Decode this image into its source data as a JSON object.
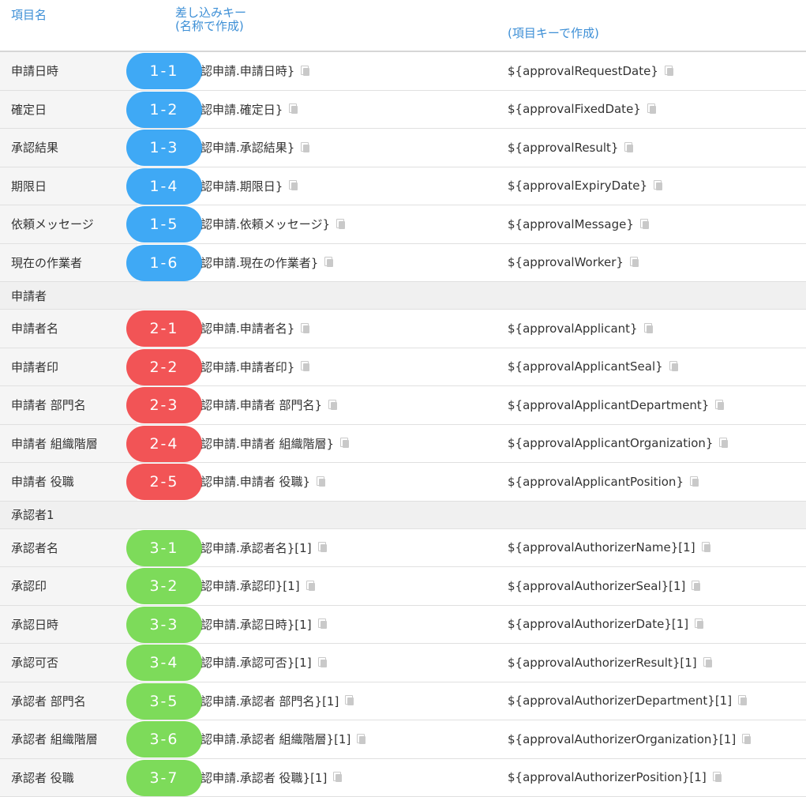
{
  "header": {
    "col1": "項目名",
    "col2_line1": "差し込みキー",
    "col2_line2": "(名称で作成)",
    "col3": "(項目キーで作成)"
  },
  "colors": {
    "header_text": "#3d8fd6",
    "badge_blue": "#3fa9f5",
    "badge_red": "#f25456",
    "badge_green": "#7ddb5a"
  },
  "icons": {
    "copy": "copy-icon"
  },
  "sections": [
    {
      "title": "",
      "rows": [
        {
          "label": "申請日時",
          "name_key": "認申請.申請日時}",
          "item_key": "${approvalRequestDate}",
          "badge": "1-1",
          "color": "blue"
        },
        {
          "label": "確定日",
          "name_key": "認申請.確定日}",
          "item_key": "${approvalFixedDate}",
          "badge": "1-2",
          "color": "blue"
        },
        {
          "label": "承認結果",
          "name_key": "認申請.承認結果}",
          "item_key": "${approvalResult}",
          "badge": "1-3",
          "color": "blue"
        },
        {
          "label": "期限日",
          "name_key": "認申請.期限日}",
          "item_key": "${approvalExpiryDate}",
          "badge": "1-4",
          "color": "blue"
        },
        {
          "label": "依頼メッセージ",
          "name_key": "認申請.依頼メッセージ}",
          "item_key": "${approvalMessage}",
          "badge": "1-5",
          "color": "blue"
        },
        {
          "label": "現在の作業者",
          "name_key": "認申請.現在の作業者}",
          "item_key": "${approvalWorker}",
          "badge": "1-6",
          "color": "blue"
        }
      ]
    },
    {
      "title": "申請者",
      "rows": [
        {
          "label": "申請者名",
          "name_key": "認申請.申請者名}",
          "item_key": "${approvalApplicant}",
          "badge": "2-1",
          "color": "red"
        },
        {
          "label": "申請者印",
          "name_key": "認申請.申請者印}",
          "item_key": "${approvalApplicantSeal}",
          "badge": "2-2",
          "color": "red"
        },
        {
          "label": "申請者 部門名",
          "name_key": "認申請.申請者 部門名}",
          "item_key": "${approvalApplicantDepartment}",
          "badge": "2-3",
          "color": "red"
        },
        {
          "label": "申請者 組織階層",
          "name_key": "認申請.申請者 組織階層}",
          "item_key": "${approvalApplicantOrganization}",
          "badge": "2-4",
          "color": "red"
        },
        {
          "label": "申請者 役職",
          "name_key": "認申請.申請者 役職}",
          "item_key": "${approvalApplicantPosition}",
          "badge": "2-5",
          "color": "red"
        }
      ]
    },
    {
      "title": "承認者1",
      "rows": [
        {
          "label": "承認者名",
          "name_key": "認申請.承認者名}[1]",
          "item_key": "${approvalAuthorizerName}[1]",
          "badge": "3-1",
          "color": "green"
        },
        {
          "label": "承認印",
          "name_key": "認申請.承認印}[1]",
          "item_key": "${approvalAuthorizerSeal}[1]",
          "badge": "3-2",
          "color": "green"
        },
        {
          "label": "承認日時",
          "name_key": "認申請.承認日時}[1]",
          "item_key": "${approvalAuthorizerDate}[1]",
          "badge": "3-3",
          "color": "green"
        },
        {
          "label": "承認可否",
          "name_key": "認申請.承認可否}[1]",
          "item_key": "${approvalAuthorizerResult}[1]",
          "badge": "3-4",
          "color": "green"
        },
        {
          "label": "承認者 部門名",
          "name_key": "認申請.承認者 部門名}[1]",
          "item_key": "${approvalAuthorizerDepartment}[1]",
          "badge": "3-5",
          "color": "green"
        },
        {
          "label": "承認者 組織階層",
          "name_key": "認申請.承認者 組織階層}[1]",
          "item_key": "${approvalAuthorizerOrganization}[1]",
          "badge": "3-6",
          "color": "green"
        },
        {
          "label": "承認者 役職",
          "name_key": "認申請.承認者 役職}[1]",
          "item_key": "${approvalAuthorizerPosition}[1]",
          "badge": "3-7",
          "color": "green"
        }
      ]
    }
  ]
}
